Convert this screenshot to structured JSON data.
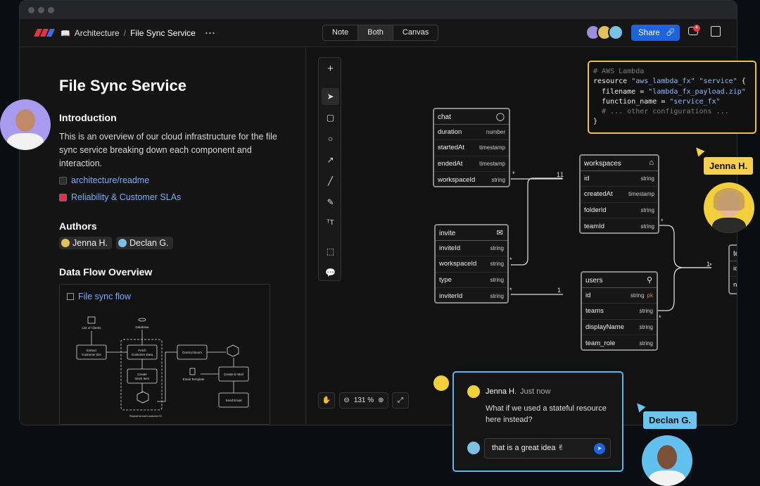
{
  "breadcrumb": {
    "folder": "Architecture",
    "separator": "/",
    "page": "File Sync Service"
  },
  "view_modes": [
    "Note",
    "Both",
    "Canvas"
  ],
  "view_mode_active": "Both",
  "share_label": "Share",
  "notification_count": "4",
  "doc": {
    "title": "File Sync Service",
    "intro_heading": "Introduction",
    "intro_text": "This is an overview of our cloud infrastructure for the file sync service breaking down each component and interaction.",
    "links": [
      "architecture/readme",
      "Reliability & Customer SLAs"
    ],
    "authors_heading": "Authors",
    "authors": [
      "Jenna H.",
      "Declan G."
    ],
    "dataflow_heading": "Data Flow Overview",
    "flow_title": "File sync flow",
    "flow_nodes": {
      "clients": "List of Clients",
      "database": "Database",
      "extract": [
        "Extract",
        "Customer IDs"
      ],
      "fetch": [
        "Fetch",
        "Customer Data"
      ],
      "create_work": [
        "Create",
        "Work Item"
      ],
      "control": "Control Room",
      "email_tpl": "Email Template",
      "create_email": "Create E-Mail",
      "send_email": "Send Email",
      "repeat": "Repeat for each customer ID"
    }
  },
  "zoom_level": "131 %",
  "tables": {
    "chat": {
      "name": "chat",
      "icon": "chat-bubble-icon",
      "rows": [
        [
          "duration",
          "number"
        ],
        [
          "startedAt",
          "timestamp"
        ],
        [
          "endedAt",
          "timestamp"
        ],
        [
          "workspaceId",
          "string"
        ]
      ]
    },
    "workspaces": {
      "name": "workspaces",
      "icon": "home-icon",
      "rows": [
        [
          "id",
          "string"
        ],
        [
          "createdAt",
          "timestamp"
        ],
        [
          "folderId",
          "string"
        ],
        [
          "teamId",
          "string"
        ]
      ]
    },
    "invite": {
      "name": "invite",
      "icon": "envelope-icon",
      "rows": [
        [
          "inviteId",
          "string"
        ],
        [
          "workspaceId",
          "string"
        ],
        [
          "type",
          "string"
        ],
        [
          "inviterId",
          "string"
        ]
      ]
    },
    "users": {
      "name": "users",
      "icon": "user-icon",
      "rows": [
        [
          "id",
          "string"
        ],
        [
          "teams",
          "string"
        ],
        [
          "displayName",
          "string"
        ],
        [
          "team_role",
          "string"
        ]
      ],
      "pk": "pk"
    },
    "teams": {
      "name": "teams",
      "rows": [
        "id",
        "name"
      ]
    }
  },
  "relation_labels": {
    "many": "*",
    "one": "1"
  },
  "code_block": {
    "line1": "# AWS Lambda",
    "line2a": "resource ",
    "line2b": "\"aws_lambda_fx\"",
    "line2c": " ",
    "line2d": "\"service\"",
    "line2e": " {",
    "line3a": "  filename = ",
    "line3b": "\"lambda_fx_payload.zip\"",
    "line4a": "  function_name = ",
    "line4b": "\"service_fx\"",
    "line5": "  # ... other configurations ...",
    "line6": "}"
  },
  "cursors": {
    "jenna": "Jenna H.",
    "declan": "Declan G."
  },
  "comment": {
    "author": "Jenna H.",
    "time": "Just now",
    "text": "What if we used a stateful resource here instead?",
    "reply": "that is a great idea ✌"
  },
  "colors": {
    "accent": "#1d63e0",
    "code_border": "#f2c230",
    "comment_border": "#5bb6ea",
    "jenna_tag": "#f6d04d",
    "declan_tag": "#6cc4f0"
  }
}
